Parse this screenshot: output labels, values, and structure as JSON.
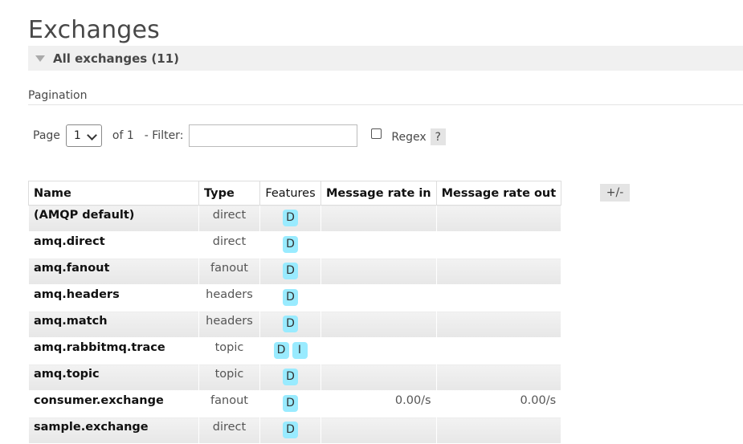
{
  "page_title": "Exchanges",
  "section": {
    "title": "All exchanges (11)"
  },
  "pagination": {
    "label": "Pagination",
    "page_label": "Page",
    "page_value": "1",
    "of_label": "of 1",
    "filter_label": "- Filter:",
    "filter_value": "",
    "regex_label": "Regex",
    "regex_checked": false,
    "help_label": "?"
  },
  "table": {
    "columns": [
      "Name",
      "Type",
      "Features",
      "Message rate in",
      "Message rate out"
    ],
    "toggle_label": "+/-",
    "rows": [
      {
        "name": "(AMQP default)",
        "type": "direct",
        "features": [
          "D"
        ],
        "rate_in": "",
        "rate_out": ""
      },
      {
        "name": "amq.direct",
        "type": "direct",
        "features": [
          "D"
        ],
        "rate_in": "",
        "rate_out": ""
      },
      {
        "name": "amq.fanout",
        "type": "fanout",
        "features": [
          "D"
        ],
        "rate_in": "",
        "rate_out": ""
      },
      {
        "name": "amq.headers",
        "type": "headers",
        "features": [
          "D"
        ],
        "rate_in": "",
        "rate_out": ""
      },
      {
        "name": "amq.match",
        "type": "headers",
        "features": [
          "D"
        ],
        "rate_in": "",
        "rate_out": ""
      },
      {
        "name": "amq.rabbitmq.trace",
        "type": "topic",
        "features": [
          "D",
          "I"
        ],
        "rate_in": "",
        "rate_out": ""
      },
      {
        "name": "amq.topic",
        "type": "topic",
        "features": [
          "D"
        ],
        "rate_in": "",
        "rate_out": ""
      },
      {
        "name": "consumer.exchange",
        "type": "fanout",
        "features": [
          "D"
        ],
        "rate_in": "0.00/s",
        "rate_out": "0.00/s"
      },
      {
        "name": "sample.exchange",
        "type": "direct",
        "features": [
          "D"
        ],
        "rate_in": "",
        "rate_out": ""
      }
    ]
  },
  "colors": {
    "badge": "#99ebff",
    "header_bg": "#f0f0f0",
    "text": "#484848"
  }
}
